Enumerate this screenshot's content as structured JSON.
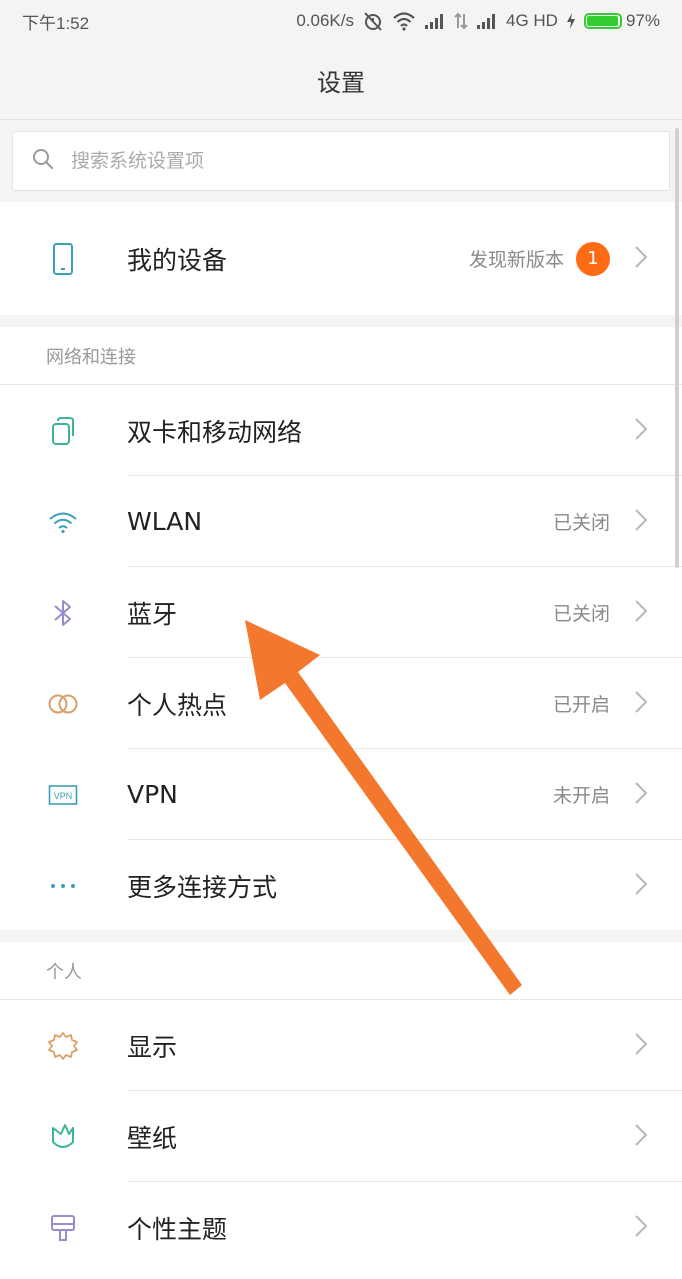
{
  "status_bar": {
    "time": "下午1:52",
    "speed": "0.06K/s",
    "network": "4G HD",
    "battery": "97%",
    "battery_level": 0.97
  },
  "title": "设置",
  "search": {
    "placeholder": "搜索系统设置项"
  },
  "device": {
    "label": "我的设备",
    "value": "发现新版本",
    "badge": "1"
  },
  "sections": {
    "network": {
      "header": "网络和连接",
      "items": [
        {
          "label": "双卡和移动网络",
          "value": "",
          "icon": "sim-cards-icon"
        },
        {
          "label": "WLAN",
          "value": "已关闭",
          "icon": "wifi-icon"
        },
        {
          "label": "蓝牙",
          "value": "已关闭",
          "icon": "bluetooth-icon"
        },
        {
          "label": "个人热点",
          "value": "已开启",
          "icon": "hotspot-icon"
        },
        {
          "label": "VPN",
          "value": "未开启",
          "icon": "vpn-icon"
        },
        {
          "label": "更多连接方式",
          "value": "",
          "icon": "more-dots-icon"
        }
      ]
    },
    "personal": {
      "header": "个人",
      "items": [
        {
          "label": "显示",
          "value": "",
          "icon": "display-brightness-icon"
        },
        {
          "label": "壁纸",
          "value": "",
          "icon": "wallpaper-icon"
        },
        {
          "label": "个性主题",
          "value": "",
          "icon": "theme-brush-icon"
        }
      ]
    }
  },
  "colors": {
    "accent_orange": "#ff6a14",
    "arrow_orange": "#f4772e",
    "icon_teal": "#3a9fb8",
    "icon_green": "#3fb39a",
    "icon_purple": "#9a8ad0",
    "icon_tan": "#d9a06a"
  },
  "arrow_icon": "annotation-arrow-icon",
  "vpn_icon_text": "VPN"
}
